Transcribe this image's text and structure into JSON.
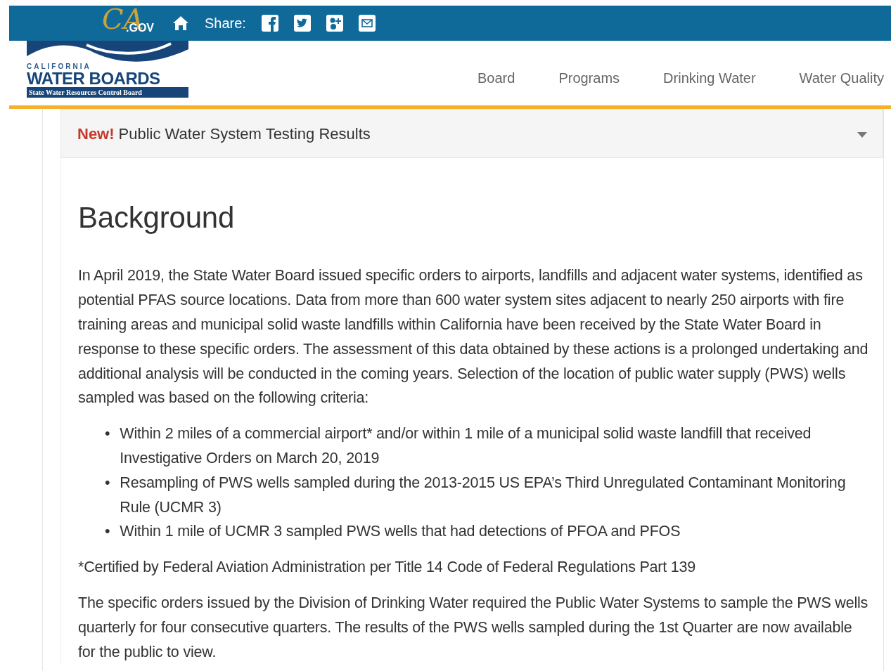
{
  "top_bar": {
    "ca_logo": {
      "script": "CA",
      "domain": ".GOV"
    },
    "share_label": "Share:"
  },
  "logo": {
    "state": "CALIFORNIA",
    "name": "WATER BOARDS",
    "subtitle": "State Water Resources Control Board"
  },
  "nav": [
    {
      "label": "Board"
    },
    {
      "label": "Programs"
    },
    {
      "label": "Drinking Water"
    },
    {
      "label": "Water Quality"
    }
  ],
  "panel": {
    "flag": "New!",
    "title": "Public Water System Testing Results",
    "expanded": true
  },
  "heading": "Background",
  "intro": "In April 2019, the State Water Board issued specific orders to airports, landfills and adjacent water systems, identified as potential PFAS source locations. Data from more than 600 water system sites adjacent to nearly 250 airports with fire training areas and municipal solid waste landfills within California have been received by the State Water Board in response to these specific orders.  The assessment of this data obtained by these actions is a prolonged undertaking and additional analysis will be conducted in the coming years.  Selection of the location of public water supply (PWS) wells sampled was based on the following criteria:",
  "criteria": [
    {
      "marker": "•",
      "text": "Within 2 miles of a commercial airport* and/or within 1 mile of a municipal solid waste landfill that received Investigative Orders on March 20, 2019"
    },
    {
      "marker": "•",
      "text": "Resampling of PWS wells sampled during the 2013-2015 US EPA’s Third Unregulated Contaminant Monitoring Rule (UCMR 3)"
    },
    {
      "marker": "•",
      "text": "Within 1 mile of UCMR 3 sampled PWS wells that had detections of PFOA and PFOS"
    }
  ],
  "footnote": "*Certified by Federal Aviation Administration per Title 14 Code of Federal Regulations Part 139",
  "closing": "The specific orders issued by the Division of Drinking Water required the Public Water Systems to sample the PWS wells quarterly for four consecutive quarters. The results of the PWS wells sampled during the 1st Quarter are now available for the public to view."
}
